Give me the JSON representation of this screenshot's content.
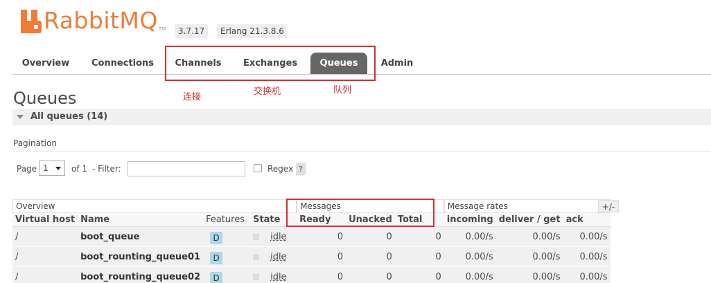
{
  "header": {
    "logo_text": "RabbitMQ",
    "logo_tm": "TM",
    "version": "3.7.17",
    "erlang": "Erlang 21.3.8.6"
  },
  "tabs": [
    {
      "label": "Overview"
    },
    {
      "label": "Connections"
    },
    {
      "label": "Channels"
    },
    {
      "label": "Exchanges"
    },
    {
      "label": "Queues",
      "active": true
    },
    {
      "label": "Admin"
    }
  ],
  "annotations": {
    "channels": "连接",
    "exchanges": "交换机",
    "queues": "队列"
  },
  "page": {
    "title": "Queues",
    "section": "All queues (14)",
    "pagination_label": "Pagination"
  },
  "filter": {
    "page_label": "Page",
    "page_value": "1",
    "of_label": "of 1",
    "filter_label": "- Filter:",
    "filter_value": "",
    "regex_label": "Regex",
    "help": "?"
  },
  "table": {
    "groups": {
      "overview": "Overview",
      "messages": "Messages",
      "rates": "Message rates",
      "toggle": "+/-"
    },
    "columns": {
      "vhost": "Virtual host",
      "name": "Name",
      "features": "Features",
      "state": "State",
      "ready": "Ready",
      "unacked": "Unacked",
      "total": "Total",
      "incoming": "incoming",
      "deliver": "deliver / get",
      "ack": "ack"
    },
    "rows": [
      {
        "vhost": "/",
        "name": "boot_queue",
        "feature": "D",
        "state": "idle",
        "ready": "0",
        "unacked": "0",
        "total": "0",
        "incoming": "0.00/s",
        "deliver": "0.00/s",
        "ack": "0.00/s"
      },
      {
        "vhost": "/",
        "name": "boot_rounting_queue01",
        "feature": "D",
        "state": "idle",
        "ready": "0",
        "unacked": "0",
        "total": "0",
        "incoming": "0.00/s",
        "deliver": "0.00/s",
        "ack": "0.00/s"
      },
      {
        "vhost": "/",
        "name": "boot_rounting_queue02",
        "feature": "D",
        "state": "idle",
        "ready": "0",
        "unacked": "0",
        "total": "0",
        "incoming": "0.00/s",
        "deliver": "0.00/s",
        "ack": "0.00/s"
      }
    ]
  },
  "colors": {
    "brand": "#f07b35",
    "active_tab": "#666666",
    "annotation": "#d32f2f",
    "feature_badge": "#add8e6"
  }
}
